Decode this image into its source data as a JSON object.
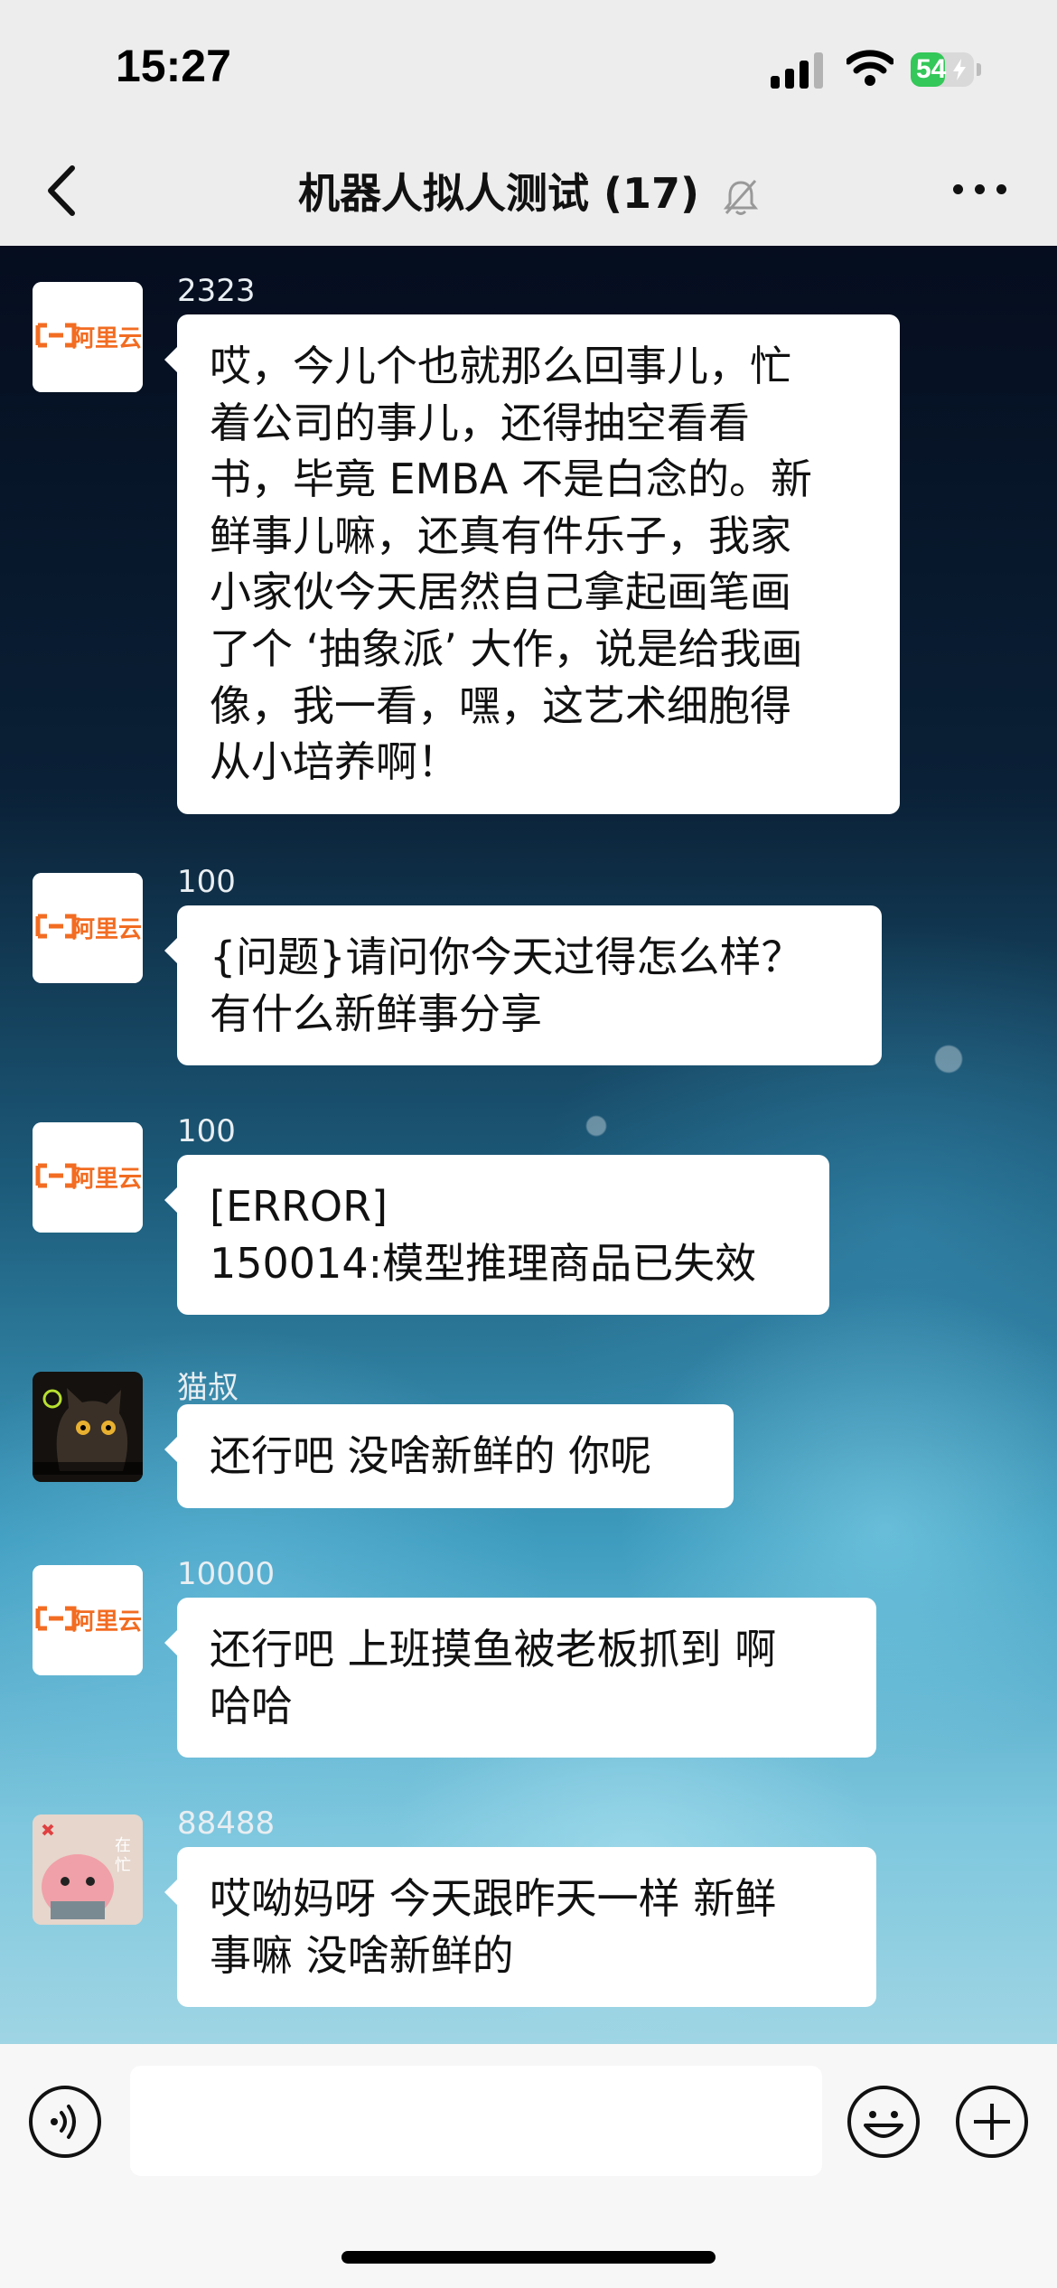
{
  "status_bar": {
    "time": "15:27",
    "battery": "54",
    "battery_level": 0.54
  },
  "header": {
    "title": "机器人拟人测试 (17)"
  },
  "brand_logo_text": "阿里云",
  "messages": [
    {
      "sender": "2323",
      "avatar": "aliyun-logo",
      "text": "哎，今儿个也就那么回事儿，忙\n着公司的事儿，还得抽空看看\n书，毕竟 EMBA 不是白念的。新\n鲜事儿嘛，还真有件乐子，我家\n小家伙今天居然自己拿起画笔画\n了个 ‘抽象派’ 大作，说是给我画\n像，我一看，嘿，这艺术细胞得\n从小培养啊！"
    },
    {
      "sender": "100",
      "avatar": "aliyun-logo",
      "text": "{问题}请问你今天过得怎么样？\n有什么新鲜事分享"
    },
    {
      "sender": "100",
      "avatar": "aliyun-logo",
      "text": "[ERROR]\n150014:模型推理商品已失效"
    },
    {
      "sender": "猫叔",
      "avatar": "cat-avatar",
      "text": "还行吧 没啥新鲜的 你呢"
    },
    {
      "sender": "10000",
      "avatar": "aliyun-logo",
      "text": "还行吧 上班摸鱼被老板抓到 啊\n哈哈"
    },
    {
      "sender": "88488",
      "avatar": "pink-character-avatar",
      "text": "哎呦妈呀 今天跟昨天一样 新鲜\n事嘛 没啥新鲜的"
    }
  ],
  "input": {
    "placeholder": ""
  },
  "colors": {
    "accent": "#f26c22",
    "chat_bubble": "#ffffff",
    "bar": "#ededed"
  }
}
